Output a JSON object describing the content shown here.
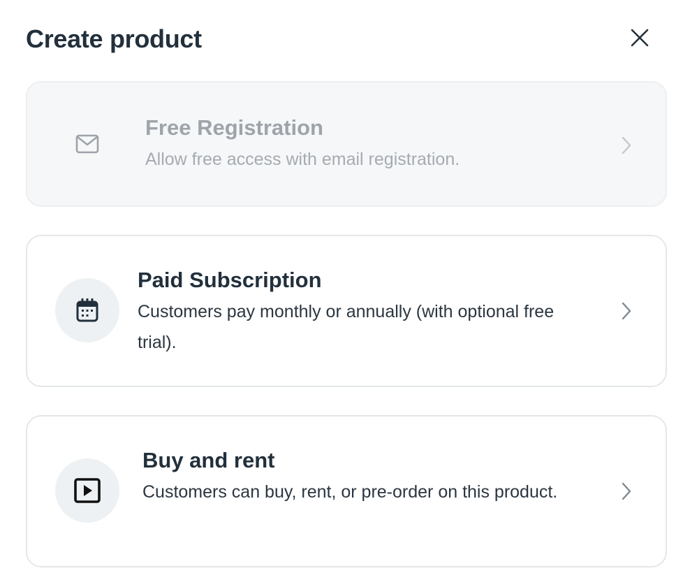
{
  "modal": {
    "title": "Create product",
    "close_icon": "close-icon"
  },
  "options": [
    {
      "title": "Free Registration",
      "description": "Allow free access with email registration.",
      "icon": "mail-icon",
      "state": "disabled"
    },
    {
      "title": "Paid Subscription",
      "description": "Customers pay monthly or annually (with optional free trial).",
      "icon": "calendar-icon",
      "state": "enabled"
    },
    {
      "title": "Buy and rent",
      "description": "Customers can buy, rent, or pre-order on this product.",
      "icon": "play-icon",
      "state": "enabled"
    }
  ],
  "colors": {
    "text_primary": "#22303c",
    "text_disabled": "#9ea4aa",
    "card_border": "#e4e7ea",
    "disabled_bg": "#f6f7f8",
    "icon_bg": "#eef1f3"
  }
}
